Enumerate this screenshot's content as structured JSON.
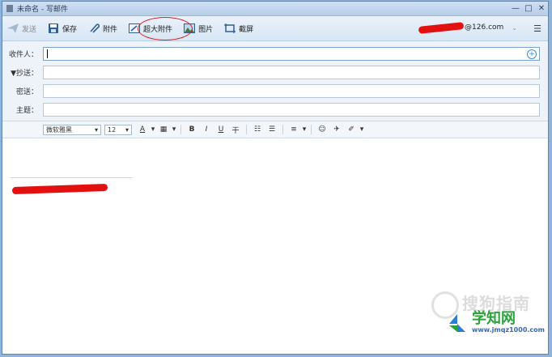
{
  "window": {
    "title": "未命名 - 写邮件",
    "min": "—",
    "max": "□",
    "close": "✕"
  },
  "toolbar": {
    "send": "发送",
    "save": "保存",
    "attach": "附件",
    "super_attach": "超大附件",
    "image": "图片",
    "screenshot": "截屏",
    "account_suffix": "@126.com",
    "chevron": "⌄",
    "menu": "☰"
  },
  "fields": {
    "to_label": "收件人：",
    "cc_label": "▼抄送：",
    "bcc_label": "密送：",
    "subject_label": "主题："
  },
  "format": {
    "font": "微软雅黑",
    "size": "12",
    "dropdown": "▾",
    "text_color": "A",
    "bold": "B",
    "italic": "I",
    "underline": "U",
    "strike": "干",
    "ul": "☷",
    "ol": "☰",
    "align": "≡",
    "emoji": "☺",
    "send_to": "✈",
    "magic": "✐"
  },
  "watermark": {
    "sogou": "搜狗指南",
    "brand": "学知网",
    "url": "www.jmqz1000.com"
  },
  "colors": {
    "accent": "#3a8ecf",
    "redaction": "#e31010",
    "brand_green": "#2aa33a"
  }
}
